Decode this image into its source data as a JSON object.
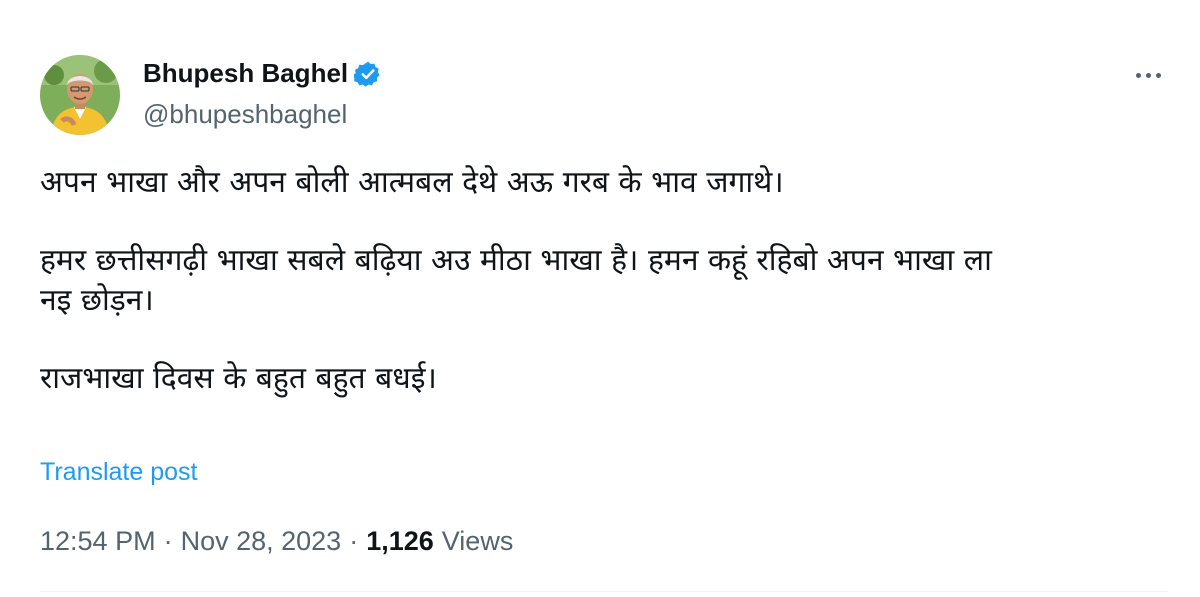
{
  "author": {
    "display_name": "Bhupesh Baghel",
    "handle": "@bhupeshbaghel",
    "verified": true
  },
  "post": {
    "paragraphs": [
      "अपन भाखा और अपन बोली आत्मबल देथे अऊ गरब के भाव जगाथे।",
      "हमर छत्तीसगढ़ी भाखा सबले बढ़िया अउ मीठा भाखा है। हमन कहूं रहिबो अपन भाखा ला\nनइ छोड़न।",
      "राजभाखा दिवस के बहुत बहुत बधई।"
    ],
    "translate_label": "Translate post",
    "time": "12:54 PM",
    "date": "Nov 28, 2023",
    "separator": "·",
    "views_count": "1,126",
    "views_label": "Views"
  },
  "icons": {
    "verified": "verified-badge-icon",
    "more": "more-options-icon"
  },
  "colors": {
    "accent": "#1d9bf0",
    "text_primary": "#0f1419",
    "text_secondary": "#536471"
  }
}
